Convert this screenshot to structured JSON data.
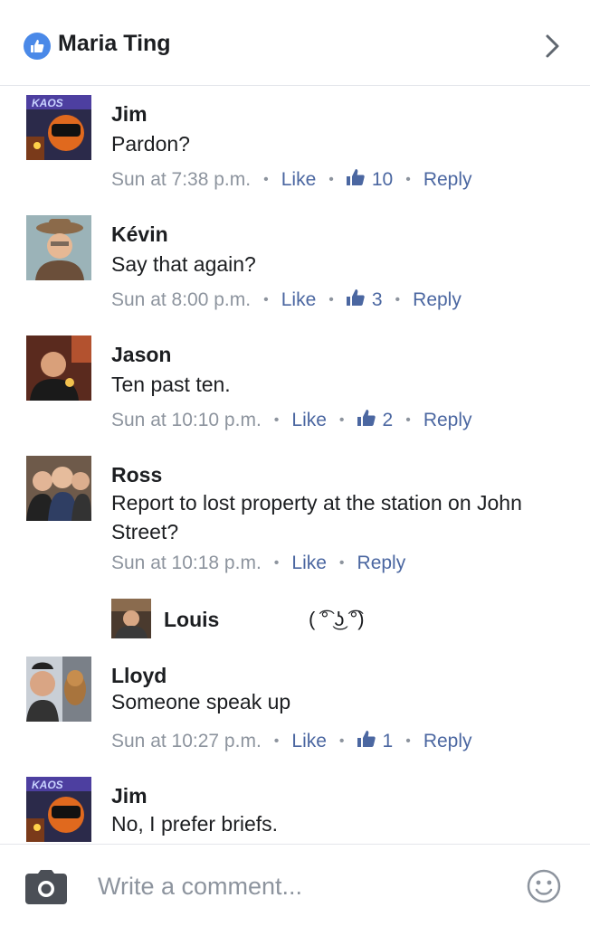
{
  "header": {
    "title": "Maria Ting"
  },
  "comments": [
    {
      "author": "Jim",
      "text": "Pardon?",
      "time": "Sun at 7:38 p.m.",
      "like": "Like",
      "likes": "10",
      "reply": "Reply"
    },
    {
      "author": "Kévin",
      "text": "Say that again?",
      "time": "Sun at 8:00 p.m.",
      "like": "Like",
      "likes": "3",
      "reply": "Reply"
    },
    {
      "author": "Jason",
      "text": "Ten past ten.",
      "time": "Sun at 10:10 p.m.",
      "like": "Like",
      "likes": "2",
      "reply": "Reply"
    },
    {
      "author": "Ross",
      "text": "Report to lost property at the station on John Street?",
      "time": "Sun at 10:18 p.m.",
      "like": "Like",
      "reply": "Reply"
    },
    {
      "author": "Lloyd",
      "text": "Someone speak up",
      "time": "Sun at 10:27 p.m.",
      "like": "Like",
      "likes": "1",
      "reply": "Reply"
    },
    {
      "author": "Jim",
      "text": "No, I prefer briefs."
    }
  ],
  "reply_preview": {
    "author": "Louis",
    "text": "( ͡° ͜ʖ ͡°)"
  },
  "composer": {
    "placeholder": "Write a comment..."
  },
  "colors": {
    "accent": "#4a89e8",
    "link": "#4b67a1",
    "meta": "#8d949e"
  },
  "icons": [
    "like-icon",
    "chevron-right-icon",
    "thumbs-up-icon",
    "camera-icon",
    "smiley-icon"
  ]
}
